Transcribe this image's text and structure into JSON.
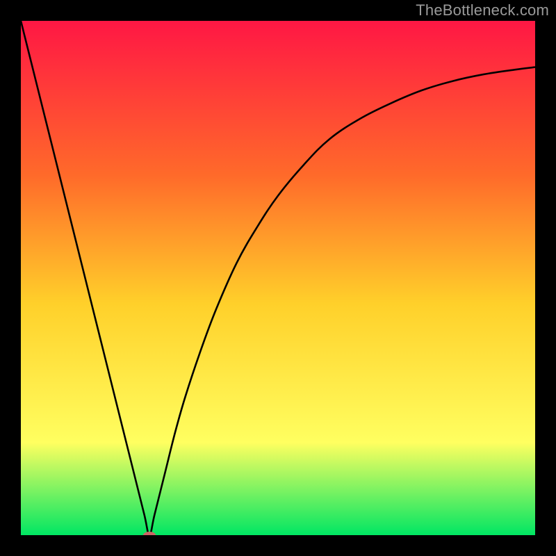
{
  "watermark": "TheBottleneck.com",
  "chart_data": {
    "type": "line",
    "title": "",
    "xlabel": "",
    "ylabel": "",
    "xlim": [
      0,
      100
    ],
    "ylim": [
      0,
      100
    ],
    "legend": false,
    "grid": false,
    "background_gradient": {
      "top": "#ff1744",
      "mid_upper": "#ff6a2a",
      "mid": "#ffd02a",
      "mid_lower": "#ffff60",
      "bottom": "#00e663"
    },
    "series": [
      {
        "name": "bottleneck-curve",
        "color": "#000000",
        "x": [
          0,
          2,
          4,
          6,
          8,
          10,
          12,
          14,
          16,
          18,
          20,
          22,
          24,
          25,
          26,
          28,
          30,
          32,
          35,
          38,
          42,
          46,
          50,
          55,
          60,
          66,
          72,
          78,
          84,
          90,
          96,
          100
        ],
        "y": [
          100,
          92,
          84,
          76,
          68,
          60,
          52,
          44,
          36,
          28,
          20,
          12,
          4,
          0,
          4,
          12,
          20,
          27,
          36,
          44,
          53,
          60,
          66,
          72,
          77,
          81,
          84,
          86.5,
          88.3,
          89.6,
          90.5,
          91
        ]
      }
    ],
    "marker": {
      "name": "bottleneck-point",
      "x": 25,
      "y": 0,
      "color": "#cc6666",
      "rx": 9,
      "ry": 5
    }
  }
}
